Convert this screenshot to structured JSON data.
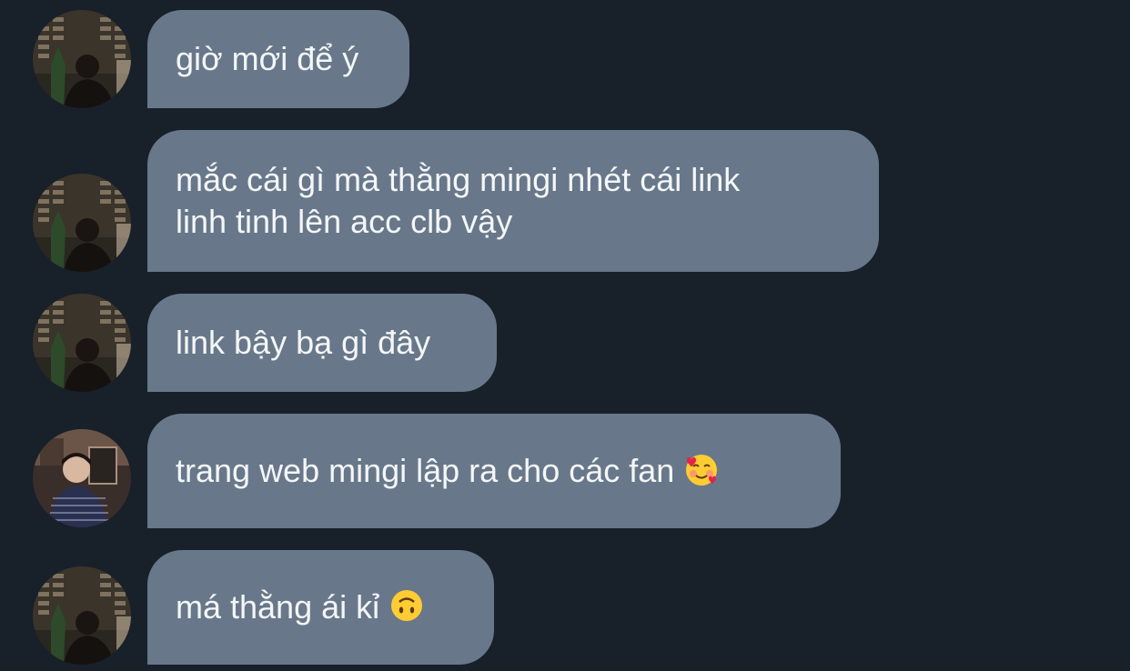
{
  "messages": [
    {
      "text": "giờ mới để ý",
      "avatar": "avatar-night-building",
      "emoji": ""
    },
    {
      "text_lines": [
        "mắc cái gì mà thằng mingi nhét cái link",
        "linh tinh lên acc clb vậy"
      ],
      "avatar": "avatar-night-building",
      "emoji": ""
    },
    {
      "text": "link bậy bạ gì đây",
      "avatar": "avatar-night-building",
      "emoji": ""
    },
    {
      "text": "trang web mingi lập ra cho các fan",
      "avatar": "avatar-striped-sweater",
      "emoji": "smiling-face-with-hearts-icon"
    },
    {
      "text": "má thằng ái kỉ",
      "avatar": "avatar-night-building",
      "emoji": "upside-down-face-icon"
    }
  ],
  "colors": {
    "background": "#18202a",
    "bubble": "#68788a",
    "bubble_text": "#f4f6f8"
  }
}
